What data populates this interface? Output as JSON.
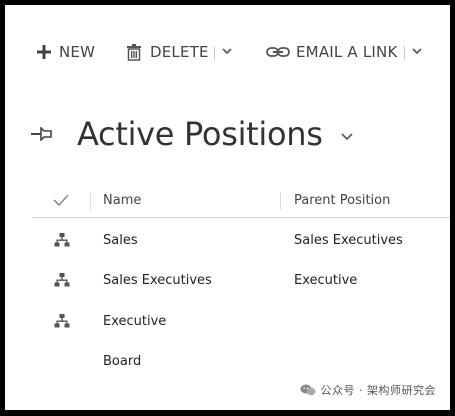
{
  "toolbar": {
    "new_label": "NEW",
    "delete_label": "DELETE",
    "email_label": "EMAIL A LINK"
  },
  "view": {
    "title": "Active Positions"
  },
  "grid": {
    "columns": [
      "Name",
      "Parent Position"
    ],
    "rows": [
      {
        "name": "Sales",
        "parent": "Sales Executives",
        "icon": "hierarchy-icon"
      },
      {
        "name": "Sales Executives",
        "parent": "Executive",
        "icon": "hierarchy-icon"
      },
      {
        "name": "Executive",
        "parent": "",
        "icon": "hierarchy-icon"
      },
      {
        "name": "Board",
        "parent": "",
        "icon": ""
      }
    ]
  },
  "watermark": {
    "text": "公众号 · 架构师研究会"
  },
  "colors": {
    "text": "#333333",
    "border": "#d4d4d4",
    "frame": "#000000"
  }
}
